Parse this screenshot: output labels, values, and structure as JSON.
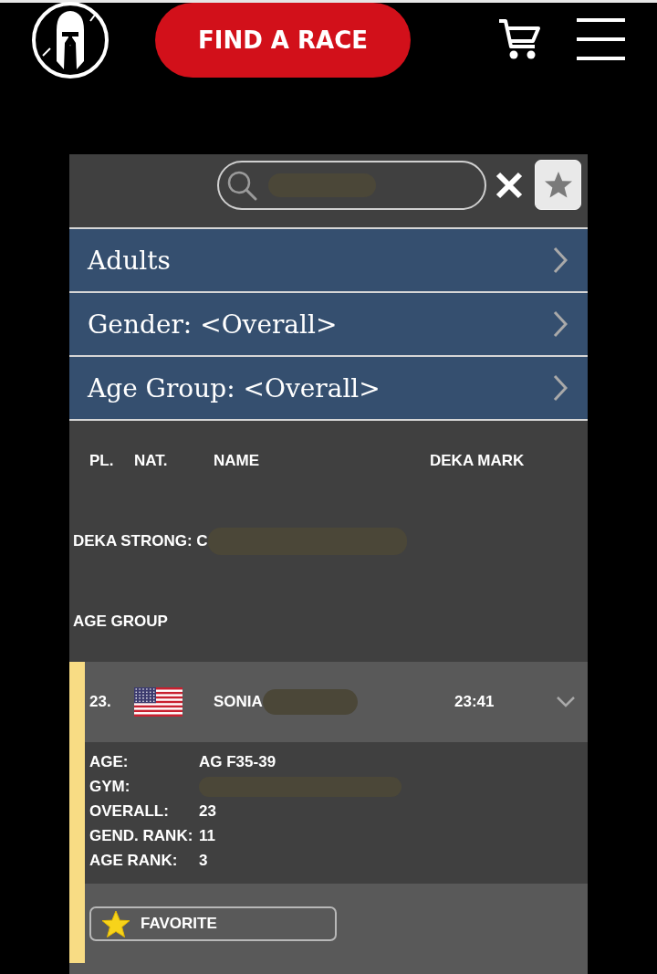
{
  "header": {
    "find_race_button": "FIND A RACE"
  },
  "search": {
    "redacted": true
  },
  "filters": [
    {
      "label": "Adults"
    },
    {
      "label": "Gender: <Overall>"
    },
    {
      "label": "Age Group: <Overall>"
    }
  ],
  "table": {
    "columns": [
      "PL.",
      "NAT.",
      "NAME",
      "DEKA MARK"
    ],
    "more_columns": [
      {
        "label": "DEKA STRONG: C",
        "redacted": true
      },
      {
        "label": "AGE GROUP"
      }
    ]
  },
  "results": [
    {
      "place": "23.",
      "name": "SONIA",
      "name_redacted": true,
      "mark": "23:41",
      "selected": true,
      "expanded": true,
      "details": [
        {
          "label": "AGE:",
          "value": "AG F35-39"
        },
        {
          "label": "GYM:",
          "redacted": true
        },
        {
          "label": "OVERALL:",
          "value": "23"
        },
        {
          "label": "GEND. RANK:",
          "value": "11"
        },
        {
          "label": "AGE RANK:",
          "value": "3"
        }
      ],
      "favorite_button": "FAVORITE"
    }
  ]
}
